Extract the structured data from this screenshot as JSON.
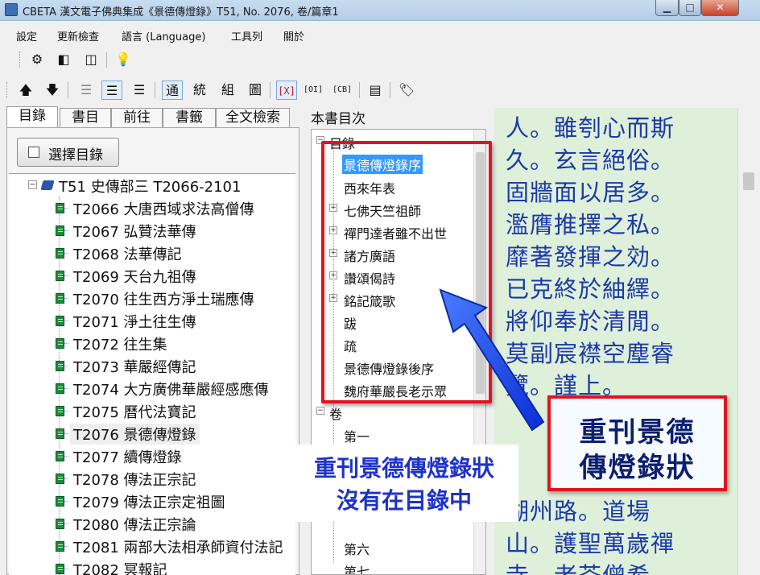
{
  "window": {
    "title": "CBETA 漢文電子佛典集成《景德傳燈錄》T51, No. 2076, 卷/篇章1",
    "minimize": "▁",
    "maximize": "□",
    "close": "✕"
  },
  "menu": [
    "設定",
    "更新檢查",
    "語言 (Language)",
    "工具列",
    "關於"
  ],
  "toolbar1": {
    "settings_icon": "gear-icon",
    "glyph_settings": "⚙",
    "glyph_panel_left": "◧",
    "glyph_panel_split": "◫",
    "glyph_bulb": "💡"
  },
  "toolbar2": {
    "glyph_up": "🡅",
    "glyph_down": "🡇",
    "glyph_layout_a": "☰",
    "glyph_layout_b": "☰",
    "glyph_layout_c": "☰",
    "tong": "通",
    "tong2": "統",
    "zu": "組",
    "tu": "圖",
    "x_mark": "[X]",
    "oi": "[OI]",
    "cb": "[CB]",
    "glyph_doc": "▤",
    "glyph_tag": "🏷"
  },
  "left_tabs": [
    "目錄",
    "書目",
    "前往",
    "書籤",
    "全文檢索"
  ],
  "select_button": "選擇目錄",
  "tree": {
    "root": "T51 史傳部三 T2066-2101",
    "items": [
      "T2066 大唐西域求法高僧傳",
      "T2067 弘贊法華傳",
      "T2068 法華傳記",
      "T2069 天台九祖傳",
      "T2070 往生西方淨土瑞應傳",
      "T2071 淨土往生傳",
      "T2072 往生集",
      "T2073 華嚴經傳記",
      "T2074 大方廣佛華嚴經感應傳",
      "T2075 曆代法寶記",
      "T2076 景德傳燈錄",
      "T2077 續傳燈錄",
      "T2078 傳法正宗記",
      "T2079 傳法正宗定祖圖",
      "T2080 傳法正宗論",
      "T2081 兩部大法相承師資付法記",
      "T2082 冥報記"
    ],
    "selected_index": 10
  },
  "middle": {
    "title": "本書目次",
    "group1": "目錄",
    "toc": [
      {
        "label": "景德傳燈錄序",
        "expandable": false,
        "selected": true
      },
      {
        "label": "西來年表",
        "expandable": false,
        "selected": false
      },
      {
        "label": "七佛天竺祖師",
        "expandable": true,
        "selected": false
      },
      {
        "label": "禪門達者雖不出世",
        "expandable": true,
        "selected": false
      },
      {
        "label": "諸方廣語",
        "expandable": true,
        "selected": false
      },
      {
        "label": "讚頌偈詩",
        "expandable": true,
        "selected": false
      },
      {
        "label": "銘記箴歌",
        "expandable": true,
        "selected": false
      },
      {
        "label": "跋",
        "expandable": false,
        "selected": false
      },
      {
        "label": "疏",
        "expandable": false,
        "selected": false
      },
      {
        "label": "景德傳燈錄後序",
        "expandable": false,
        "selected": false
      },
      {
        "label": "魏府華嚴長老示眾",
        "expandable": false,
        "selected": false
      }
    ],
    "group2": "卷",
    "juan": [
      "第一",
      "第六",
      "第七"
    ]
  },
  "text_lines": [
    "人。雖刳心而斯",
    "久。玄言絕俗。",
    "固牆面以居多。",
    "濫膺推擇之私。",
    "靡著發揮之効。",
    "已克終於紬繹。",
    "將仰奉於清閒。",
    "莫副宸襟空塵睿",
    "覽。謹上。"
  ],
  "text_lines_bottom": [
    "湖州路。道場",
    "山。護聖萬歲禪",
    "寺。老荃僧希"
  ],
  "annotation": {
    "callout_line1": "重刊景德傳燈錄狀",
    "callout_line2": "沒有在目錄中",
    "box_line1": "重刊景德",
    "box_line2": "傳燈錄狀"
  },
  "colors": {
    "annotation_red": "#e0141e",
    "annotation_blue": "#1d33c8",
    "text_blue": "#1b3aa8",
    "reading_bg": "#dff0da",
    "selection": "#3399ff"
  }
}
